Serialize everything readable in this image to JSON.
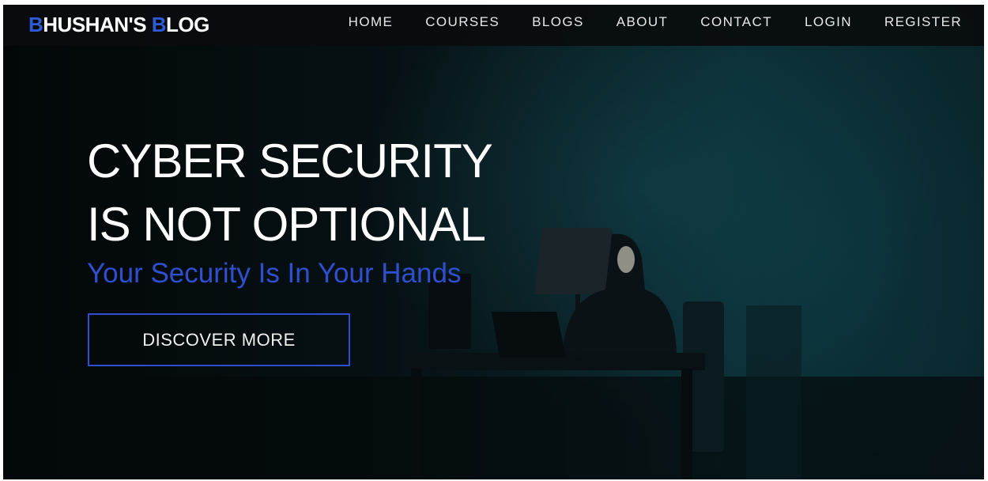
{
  "site": {
    "logo_prefix_letter": "B",
    "logo_middle": "HUSHAN'S ",
    "logo_second_letter": "B",
    "logo_suffix": "LOG",
    "accent_color": "#2f5bd6"
  },
  "nav": {
    "items": [
      "HOME",
      "COURSES",
      "BLOGS",
      "ABOUT",
      "CONTACT",
      "LOGIN",
      "REGISTER"
    ]
  },
  "hero": {
    "title_line1": "CYBER SECURITY",
    "title_line2": "IS NOT OPTIONAL",
    "subtitle": "Your Security Is In Your Hands",
    "cta_label": "DISCOVER MORE"
  }
}
